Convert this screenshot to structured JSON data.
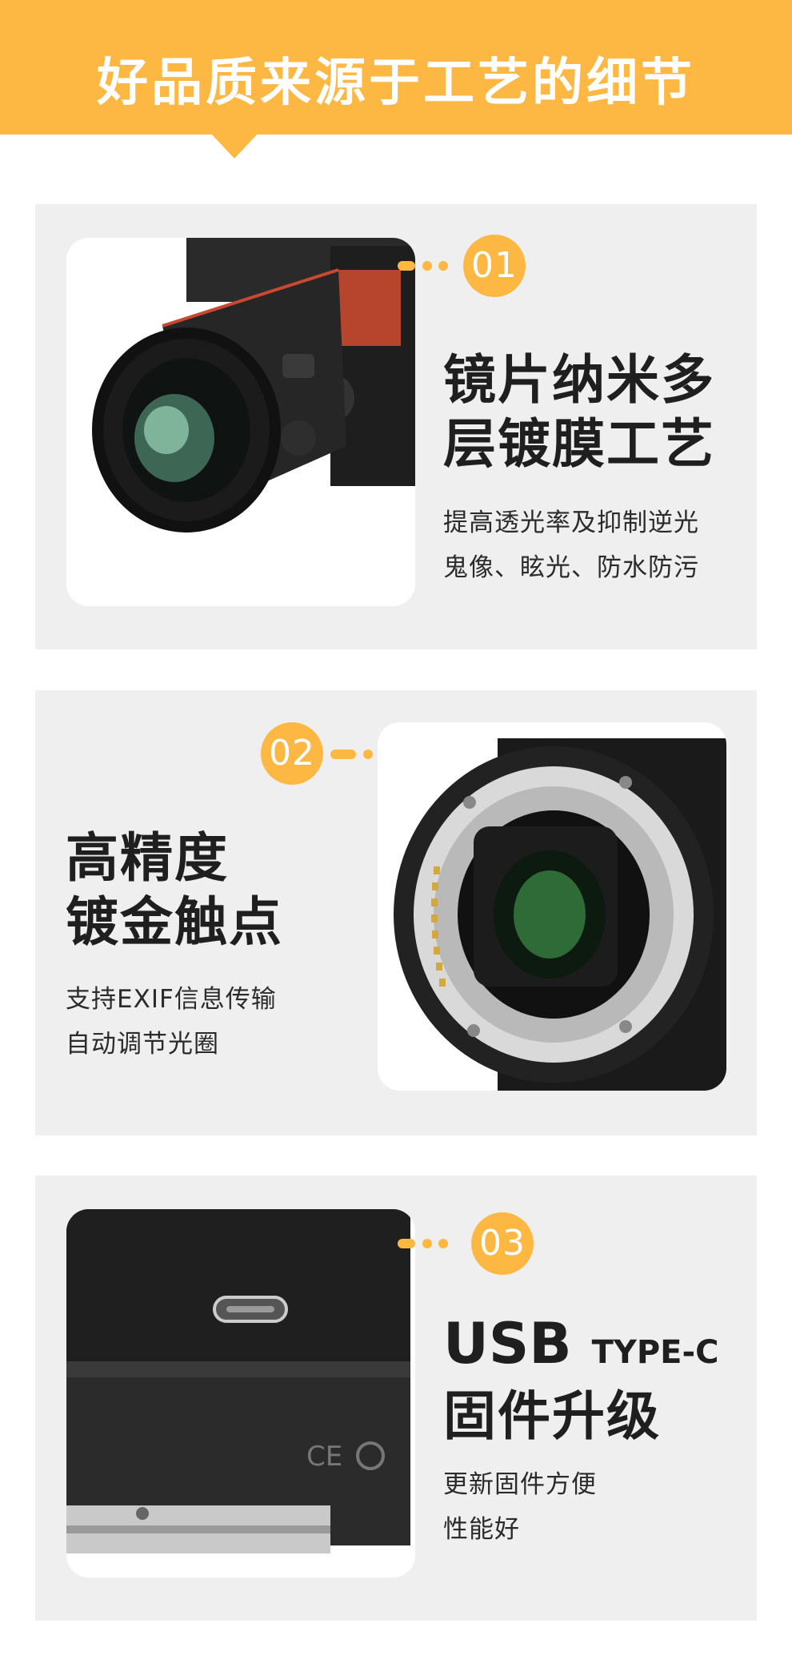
{
  "banner": {
    "title": "好品质来源于工艺的细节"
  },
  "features": [
    {
      "number": "01",
      "heading_line1": "镜片纳米多",
      "heading_line2": "层镀膜工艺",
      "desc_line1": "提高透光率及抑制逆光",
      "desc_line2": "鬼像、眩光、防水防污",
      "image_icon": "lens-front-photo"
    },
    {
      "number": "02",
      "heading_line1": "高精度",
      "heading_line2": "镀金触点",
      "desc_line1": "支持EXIF信息传输",
      "desc_line2": "自动调节光圈",
      "image_icon": "lens-mount-photo"
    },
    {
      "number": "03",
      "heading_usb": "USB",
      "heading_type": "TYPE-C",
      "heading_line2": "固件升级",
      "desc_line1": "更新固件方便",
      "desc_line2": "性能好",
      "image_icon": "usb-c-port-photo"
    }
  ],
  "colors": {
    "accent": "#fdb843",
    "card_bg": "#efefef",
    "text": "#1f1f1f"
  }
}
